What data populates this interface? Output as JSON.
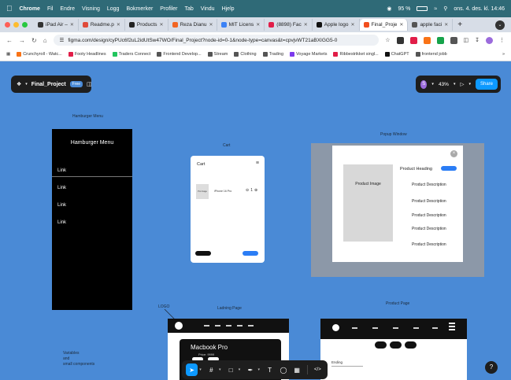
{
  "menubar": {
    "app": "Chrome",
    "items": [
      "Fil",
      "Endre",
      "Visning",
      "Logg",
      "Bokmerker",
      "Profiler",
      "Tab",
      "Vindu",
      "Hjelp"
    ],
    "battery": "95 %",
    "datetime": "ons. 4. des. kl. 14:46"
  },
  "tabs": [
    {
      "title": "iPad Air – ",
      "color": "#333333"
    },
    {
      "title": "Readme.p",
      "color": "#e04a3a"
    },
    {
      "title": "Products",
      "color": "#222222"
    },
    {
      "title": "Reza Dianu",
      "color": "#f26522"
    },
    {
      "title": "MIT Licens",
      "color": "#3b82f6"
    },
    {
      "title": "(8898) Fac",
      "color": "#e11d48"
    },
    {
      "title": "Apple logo",
      "color": "#111111"
    },
    {
      "title": "Final_Proje",
      "color": "#f24e1e"
    },
    {
      "title": "apple faci",
      "color": "#555555"
    }
  ],
  "active_tab_index": 7,
  "address": {
    "url": "figma.com/design/cyPUc6f2uL2idUtSw47WO/Final_Project?node-id=0-1&node-type=canvas&t=cpvjvWT21aBXIGG5-0"
  },
  "bookmarks": [
    {
      "label": "Crunchyroll - Watc...",
      "color": "#f97316"
    },
    {
      "label": "Footy Headlines",
      "color": "#e11d48"
    },
    {
      "label": "Traders Connect",
      "color": "#22c55e"
    },
    {
      "label": "Frontend Develop...",
      "color": "#555555"
    },
    {
      "label": "Stream",
      "color": "#555555"
    },
    {
      "label": "Clothing",
      "color": "#555555"
    },
    {
      "label": "Trading",
      "color": "#555555"
    },
    {
      "label": "Voyage Markets",
      "color": "#7c3aed"
    },
    {
      "label": "Ribbestrikket singl...",
      "color": "#e11d48"
    },
    {
      "label": "ChatGPT",
      "color": "#111111"
    },
    {
      "label": "frontend jobb",
      "color": "#555555"
    }
  ],
  "figma": {
    "file_name": "Final_Project",
    "plan_badge": "Free",
    "user_initial": "S",
    "zoom": "43%",
    "share_label": "Share",
    "frames": {
      "hamburger": {
        "label": "Hamburger Menu",
        "title": "Hamburger Menu",
        "links": [
          "Link",
          "Link",
          "Link",
          "Link"
        ]
      },
      "cart": {
        "label": "Cart",
        "title": "Cart",
        "item_image": "Pro Image",
        "item_name": "iPhone 16 Pro",
        "qty": "1"
      },
      "popup": {
        "label": "Popup Window",
        "image": "Product Image",
        "heading": "Product Heading",
        "descriptions": [
          "Product Description",
          "Product Description",
          "Product Description",
          "Product Description",
          "Product Description"
        ]
      },
      "landing": {
        "label": "Ladning Page",
        "hero_title": "Macbook Pro",
        "hero_sub": "Price: 9999"
      },
      "product": {
        "label": "Product Page",
        "text": "Ending"
      }
    },
    "logo_label": "LOGO",
    "note": [
      "Variables",
      "and",
      "small components"
    ]
  }
}
